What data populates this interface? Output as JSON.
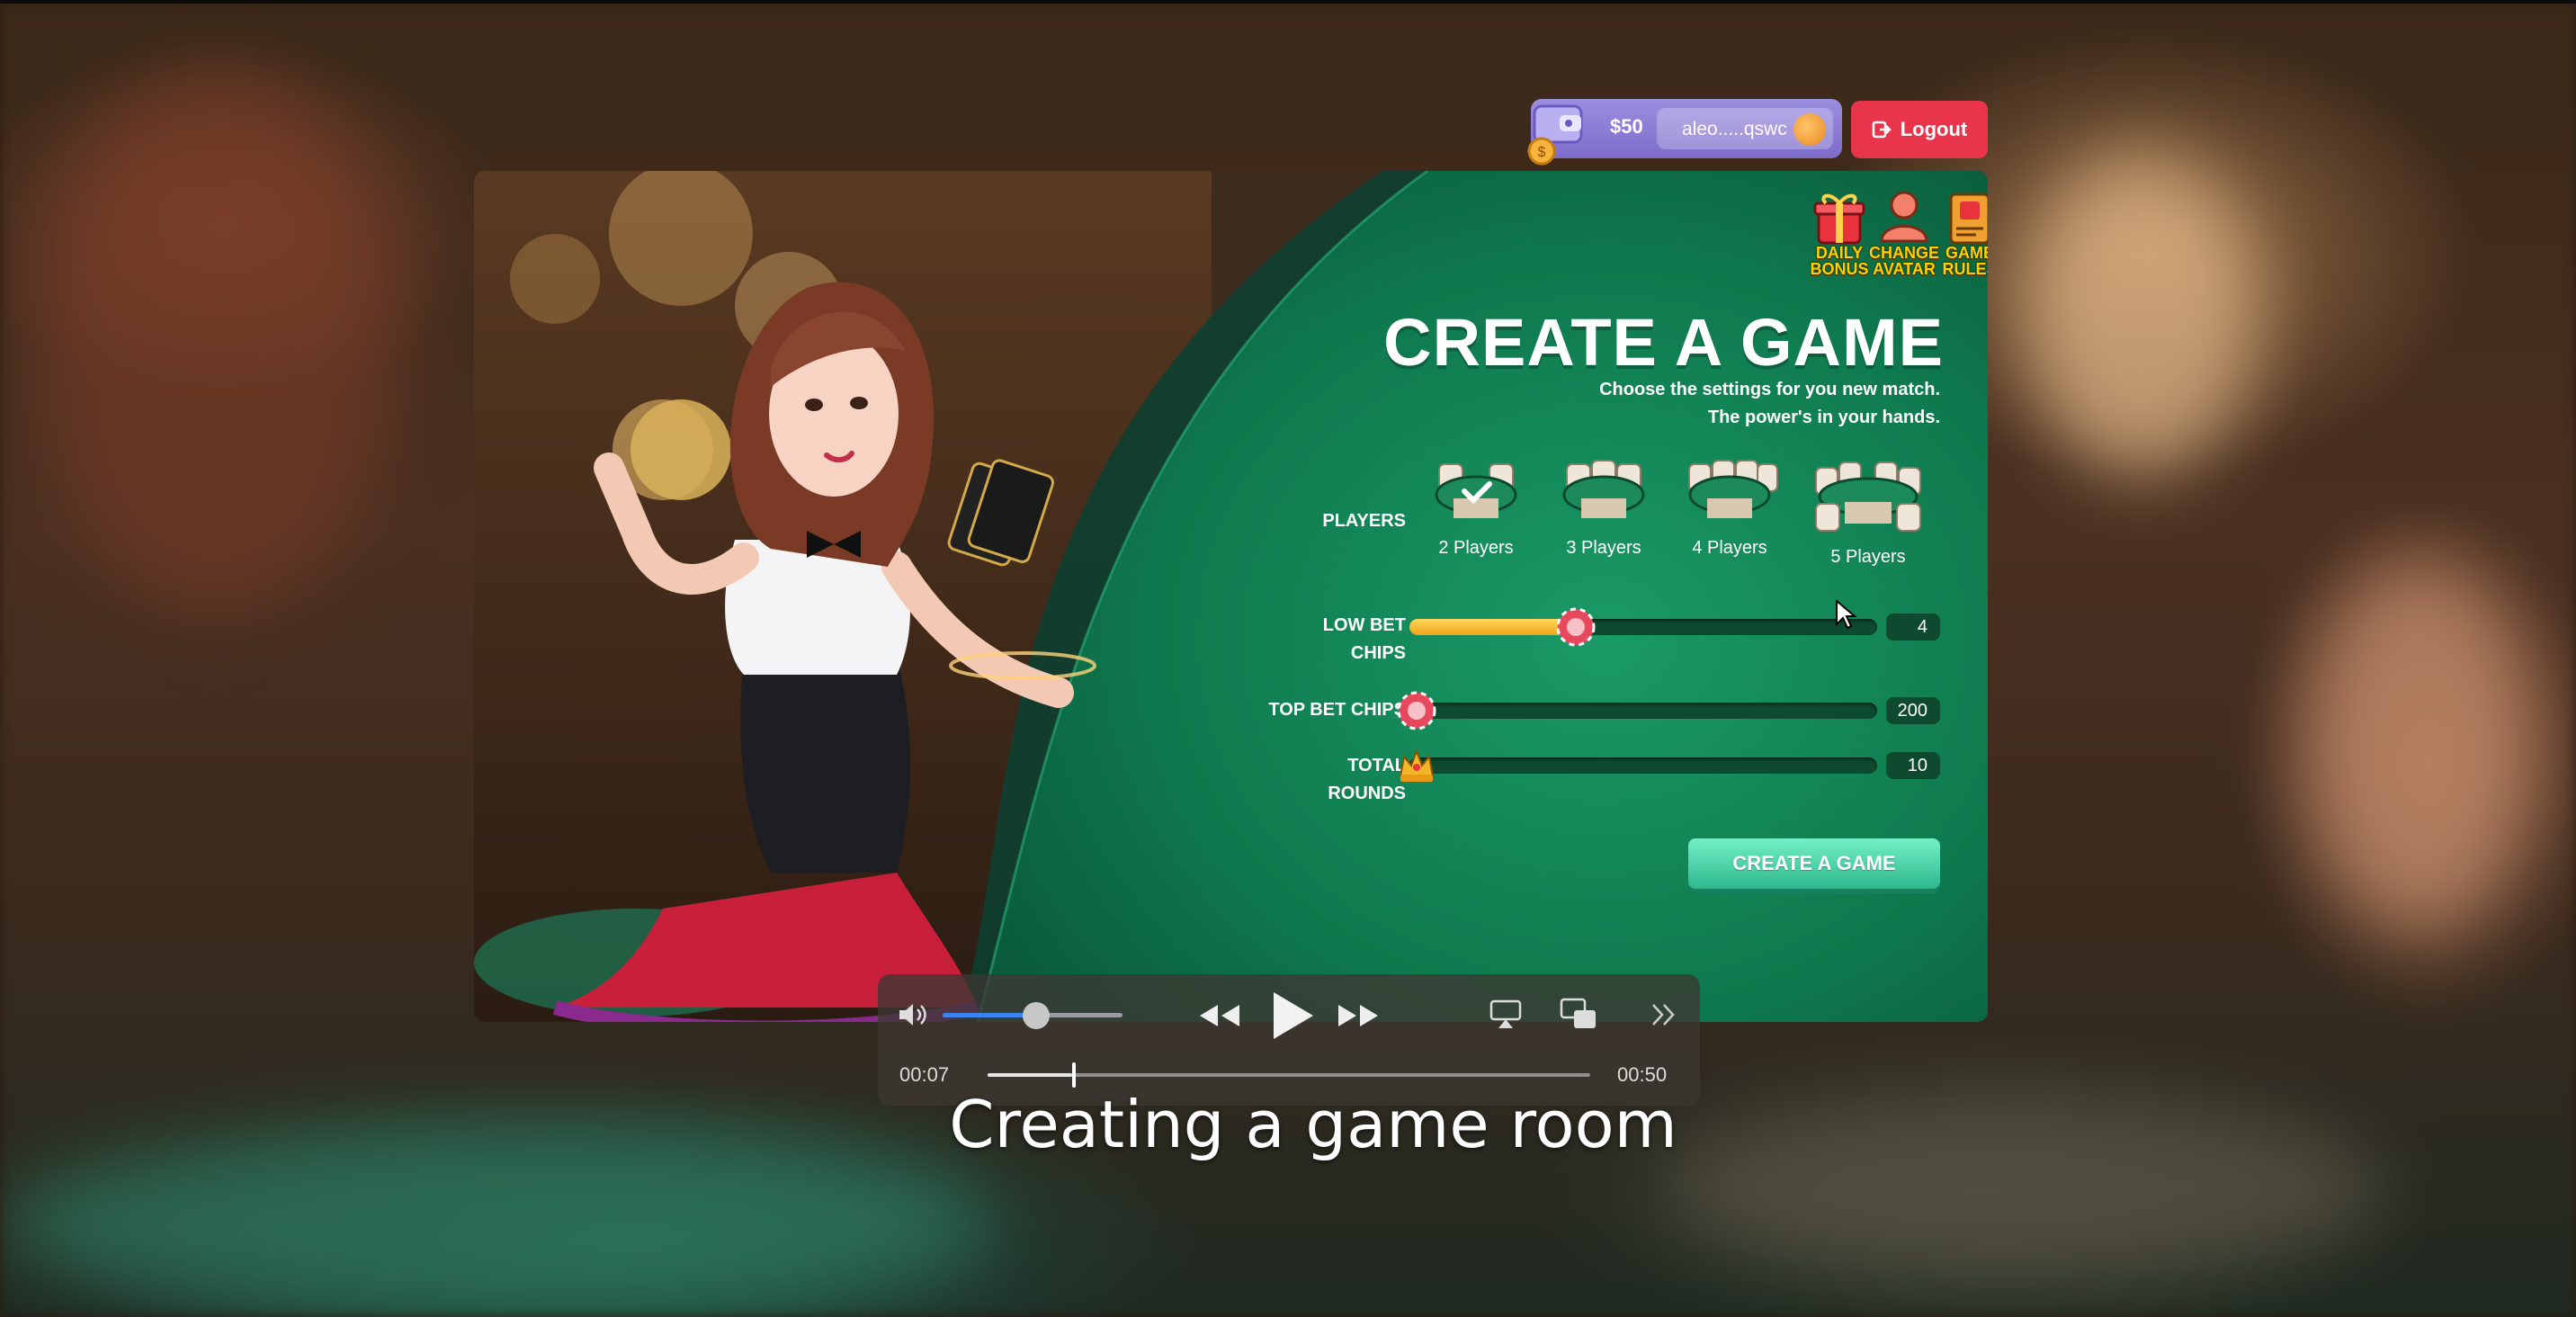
{
  "wallet": {
    "amount": "$50",
    "address": "aleo.....qswc"
  },
  "logout_label": "Logout",
  "top_icons": [
    {
      "name": "daily-bonus",
      "lines": [
        "DAILY",
        "BONUS"
      ]
    },
    {
      "name": "change-avatar",
      "lines": [
        "CHANGE",
        "AVATAR"
      ]
    },
    {
      "name": "game-rules",
      "lines": [
        "GAME",
        "RULES"
      ]
    }
  ],
  "title": "CREATE A GAME",
  "subtitle": [
    "Choose the settings for you new match.",
    "The power's in your hands."
  ],
  "players": {
    "label": "PLAYERS",
    "options": [
      "2 Players",
      "3 Players",
      "4 Players",
      "5 Players"
    ],
    "selected_index": 0
  },
  "low_bet": {
    "label_lines": [
      "LOW BET",
      "CHIPS"
    ],
    "value": "4",
    "fraction": 0.34
  },
  "top_bet": {
    "label": "TOP BET CHIPS",
    "value": "200",
    "fraction": 0.0
  },
  "rounds": {
    "label_lines": [
      "TOTAL",
      "ROUNDS"
    ],
    "value": "10",
    "fraction": 0.0
  },
  "create_button": "CREATE A GAME",
  "player": {
    "current_time": "00:07",
    "duration": "00:50",
    "progress_fraction": 0.14,
    "volume_fraction": 0.52
  },
  "caption": "Creating a game room",
  "colors": {
    "felt_green": "#13855a",
    "accent_gold": "#ffd000",
    "logout_red": "#e8354b",
    "create_teal": "#3fcf9f",
    "wallet_purple": "#8b7bd6"
  }
}
